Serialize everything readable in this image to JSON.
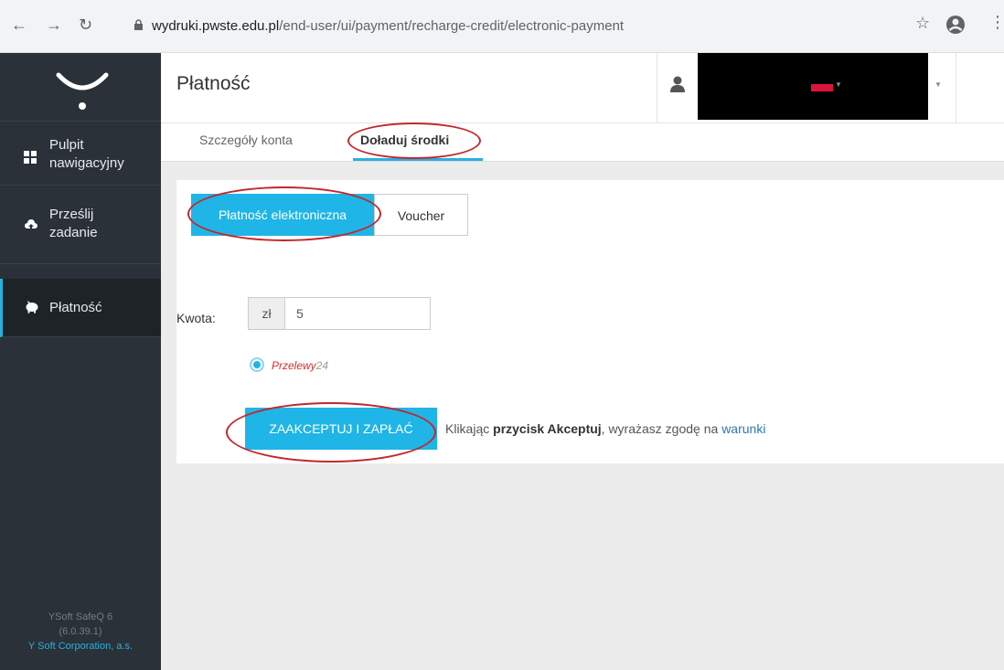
{
  "browser": {
    "url_host": "wydruki.pwste.edu.pl",
    "url_path": "/end-user/ui/payment/recharge-credit/electronic-payment",
    "back_icon": "arrow-left-icon",
    "forward_icon": "arrow-right-icon",
    "reload_icon": "reload-icon",
    "lock_icon": "lock-icon",
    "star_icon": "star-icon",
    "account_icon": "account-icon",
    "menu_icon": "kebab-menu-icon"
  },
  "sidebar": {
    "items": [
      {
        "label_line1": "Pulpit",
        "label_line2": "nawigacyjny",
        "icon": "dashboard-icon"
      },
      {
        "label_line1": "Prześlij",
        "label_line2": "zadanie",
        "icon": "upload-cloud-icon"
      },
      {
        "label": "Płatność",
        "icon": "piggy-bank-icon",
        "active": true
      }
    ],
    "footer": {
      "product": "YSoft SafeQ 6",
      "version": "(6.0.39.1)",
      "company": "Y Soft Corporation, a.s."
    }
  },
  "header": {
    "title": "Płatność"
  },
  "tabs": [
    {
      "label": "Szczegóły konta",
      "active": false
    },
    {
      "label": "Doładuj środki",
      "active": true
    }
  ],
  "payment": {
    "methods": [
      {
        "label": "Płatność elektroniczna",
        "selected": true
      },
      {
        "label": "Voucher",
        "selected": false
      }
    ],
    "amount_label": "Kwota:",
    "currency": "zł",
    "amount_value": "5",
    "provider": {
      "name_part1": "Przelewy",
      "name_part2": "24",
      "selected": true
    },
    "pay_button": "ZAAKCEPTUJ I ZAPŁAĆ",
    "terms_prefix": "Klikając ",
    "terms_bold": "przycisk Akceptuj",
    "terms_middle": ", wyrażasz zgodę na ",
    "terms_link": "warunki"
  },
  "colors": {
    "accent": "#1fb5e6",
    "sidebar_bg": "#2a3138",
    "annotation": "#c0282d",
    "flag_red": "#dc143c"
  }
}
